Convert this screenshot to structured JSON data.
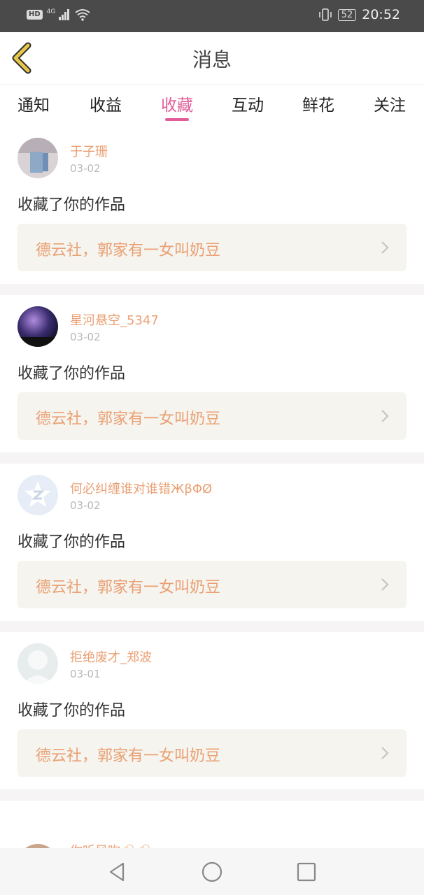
{
  "status_bar": {
    "hd_label": "HD",
    "network_label": "4G",
    "battery_level": "52",
    "time": "20:52"
  },
  "header": {
    "title": "消息"
  },
  "tabs": [
    {
      "label": "通知",
      "active": false
    },
    {
      "label": "收益",
      "active": false
    },
    {
      "label": "收藏",
      "active": true
    },
    {
      "label": "互动",
      "active": false
    },
    {
      "label": "鲜花",
      "active": false
    },
    {
      "label": "关注",
      "active": false
    }
  ],
  "messages": [
    {
      "user": "于子珊",
      "date": "03-02",
      "action": "收藏了你的作品",
      "work_title": "德云社，郭家有一女叫奶豆"
    },
    {
      "user": "星河悬空_5347",
      "date": "03-02",
      "action": "收藏了你的作品",
      "work_title": "德云社，郭家有一女叫奶豆"
    },
    {
      "user": "何必纠缠谁对谁错ЖβΦØ",
      "date": "03-02",
      "action": "收藏了你的作品",
      "work_title": "德云社，郭家有一女叫奶豆"
    },
    {
      "user": "拒绝废才_郑波",
      "date": "03-01",
      "action": "收藏了你的作品",
      "work_title": "德云社，郭家有一女叫奶豆"
    }
  ],
  "partial_item": {
    "user": "你听风吹🌨🌨"
  },
  "colors": {
    "accent": "#e15d9a",
    "username": "#eaa074",
    "work_card_bg": "#f5f4ee",
    "back_arrow": "#e7c64a"
  },
  "icons": {
    "back": "chevron-left-icon",
    "wifi": "wifi-icon",
    "signal": "signal-icon",
    "vibrate": "vibrate-icon",
    "work_arrow": "chevron-right-icon",
    "nav_back": "triangle-back-icon",
    "nav_home": "circle-home-icon",
    "nav_recent": "square-recent-icon"
  }
}
